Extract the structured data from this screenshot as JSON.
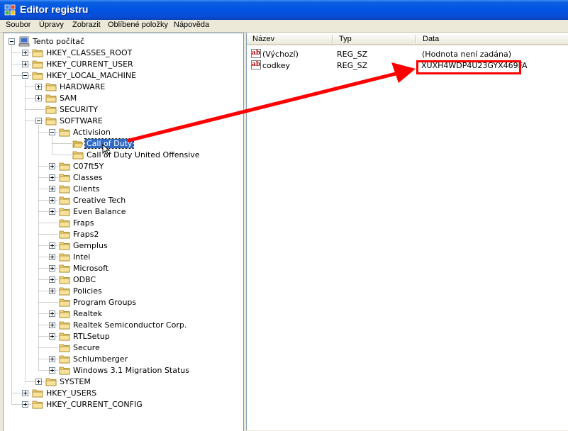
{
  "window": {
    "title": "Editor registru"
  },
  "menu": {
    "items": [
      "Soubor",
      "Úpravy",
      "Zobrazit",
      "Oblíbené položky",
      "Nápověda"
    ]
  },
  "tree": {
    "nodes": [
      {
        "label": "Tento počítač",
        "depth": 0,
        "expander": "minus",
        "icon": "computer-icon"
      },
      {
        "label": "HKEY_CLASSES_ROOT",
        "depth": 1,
        "expander": "plus",
        "icon": "folder-icon"
      },
      {
        "label": "HKEY_CURRENT_USER",
        "depth": 1,
        "expander": "plus",
        "icon": "folder-icon"
      },
      {
        "label": "HKEY_LOCAL_MACHINE",
        "depth": 1,
        "expander": "minus",
        "icon": "folder-icon"
      },
      {
        "label": "HARDWARE",
        "depth": 2,
        "expander": "plus",
        "icon": "folder-icon"
      },
      {
        "label": "SAM",
        "depth": 2,
        "expander": "plus",
        "icon": "folder-icon"
      },
      {
        "label": "SECURITY",
        "depth": 2,
        "expander": "none",
        "icon": "folder-icon"
      },
      {
        "label": "SOFTWARE",
        "depth": 2,
        "expander": "minus",
        "icon": "folder-icon"
      },
      {
        "label": "Activision",
        "depth": 3,
        "expander": "minus",
        "icon": "folder-icon"
      },
      {
        "label": "Call of Duty",
        "depth": 4,
        "expander": "none",
        "icon": "open-folder-icon",
        "selected": true
      },
      {
        "label": "Call of Duty United Offensive",
        "depth": 4,
        "expander": "none",
        "icon": "folder-icon"
      },
      {
        "label": "C07ft5Y",
        "depth": 3,
        "expander": "plus",
        "icon": "folder-icon"
      },
      {
        "label": "Classes",
        "depth": 3,
        "expander": "plus",
        "icon": "folder-icon"
      },
      {
        "label": "Clients",
        "depth": 3,
        "expander": "plus",
        "icon": "folder-icon"
      },
      {
        "label": "Creative Tech",
        "depth": 3,
        "expander": "plus",
        "icon": "folder-icon"
      },
      {
        "label": "Even Balance",
        "depth": 3,
        "expander": "plus",
        "icon": "folder-icon"
      },
      {
        "label": "Fraps",
        "depth": 3,
        "expander": "none",
        "icon": "folder-icon"
      },
      {
        "label": "Fraps2",
        "depth": 3,
        "expander": "none",
        "icon": "folder-icon"
      },
      {
        "label": "Gemplus",
        "depth": 3,
        "expander": "plus",
        "icon": "folder-icon"
      },
      {
        "label": "Intel",
        "depth": 3,
        "expander": "plus",
        "icon": "folder-icon"
      },
      {
        "label": "Microsoft",
        "depth": 3,
        "expander": "plus",
        "icon": "folder-icon"
      },
      {
        "label": "ODBC",
        "depth": 3,
        "expander": "plus",
        "icon": "folder-icon"
      },
      {
        "label": "Policies",
        "depth": 3,
        "expander": "plus",
        "icon": "folder-icon"
      },
      {
        "label": "Program Groups",
        "depth": 3,
        "expander": "none",
        "icon": "folder-icon"
      },
      {
        "label": "Realtek",
        "depth": 3,
        "expander": "plus",
        "icon": "folder-icon"
      },
      {
        "label": "Realtek Semiconductor Corp.",
        "depth": 3,
        "expander": "plus",
        "icon": "folder-icon"
      },
      {
        "label": "RTLSetup",
        "depth": 3,
        "expander": "plus",
        "icon": "folder-icon"
      },
      {
        "label": "Secure",
        "depth": 3,
        "expander": "none",
        "icon": "folder-icon"
      },
      {
        "label": "Schlumberger",
        "depth": 3,
        "expander": "plus",
        "icon": "folder-icon"
      },
      {
        "label": "Windows 3.1 Migration Status",
        "depth": 3,
        "expander": "plus",
        "icon": "folder-icon"
      },
      {
        "label": "SYSTEM",
        "depth": 2,
        "expander": "plus",
        "icon": "folder-icon"
      },
      {
        "label": "HKEY_USERS",
        "depth": 1,
        "expander": "plus",
        "icon": "folder-icon"
      },
      {
        "label": "HKEY_CURRENT_CONFIG",
        "depth": 1,
        "expander": "plus",
        "icon": "folder-icon"
      }
    ]
  },
  "values_list": {
    "columns": [
      "Název",
      "Typ",
      "Data"
    ],
    "rows": [
      {
        "name": "(Výchozí)",
        "type": "REG_SZ",
        "data": "(Hodnota není zadána)",
        "icon": "string-value-icon"
      },
      {
        "name": "codkey",
        "type": "REG_SZ",
        "data": "XUXH4WDP4U23GYX469FA",
        "icon": "string-value-icon"
      }
    ]
  },
  "annotation": {
    "color": "#ff0000"
  },
  "colors": {
    "titlebar": "#0054e3",
    "selection": "#316ac5",
    "chrome": "#ece9d8"
  }
}
